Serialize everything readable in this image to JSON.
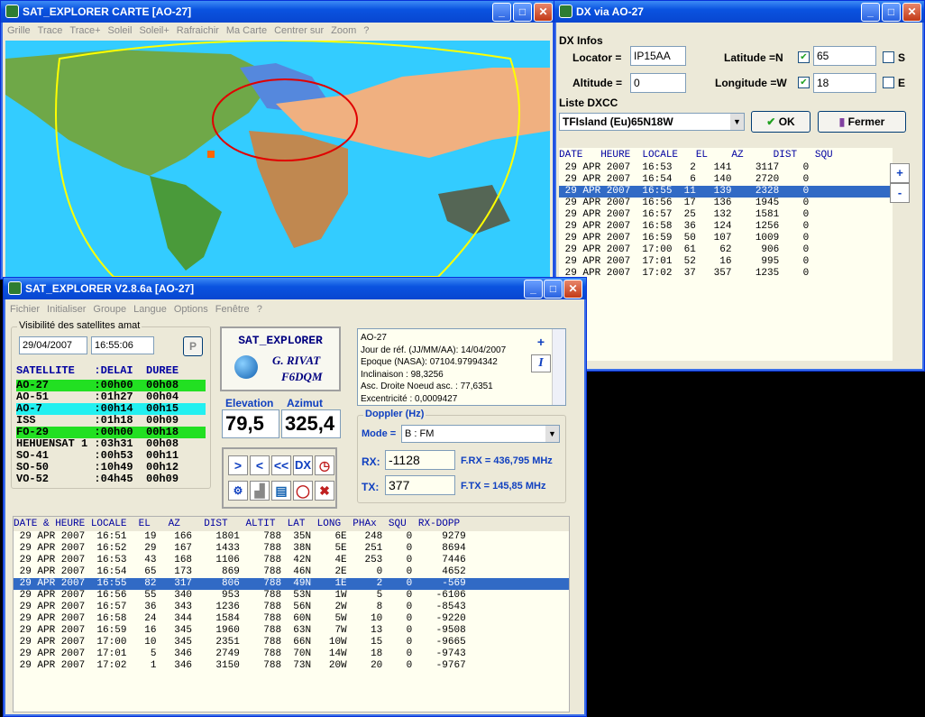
{
  "map_window": {
    "title": "SAT_EXPLORER CARTE [AO-27]",
    "menu": [
      "Grille",
      "Trace",
      "Trace+",
      "Soleil",
      "Soleil+",
      "Rafraichir",
      "Ma Carte",
      "Centrer sur",
      "Zoom",
      "?"
    ]
  },
  "dx_window": {
    "title": "DX via AO-27",
    "section": "DX Infos",
    "locator_label": "Locator =",
    "locator": "IP15AA",
    "altitude_label": "Altitude =",
    "altitude": "0",
    "latitude_label": "Latitude =N",
    "latitude": "65",
    "longitude_label": "Longitude =W",
    "longitude": "18",
    "s_label": "S",
    "e_label": "E",
    "liste_label": "Liste DXCC",
    "dxcc": "TFIsland (Eu)65N18W",
    "ok": "OK",
    "fermer": "Fermer",
    "columns": "DATE   HEURE  LOCALE   EL    AZ     DIST   SQU",
    "rows": [
      " 29 APR 2007  16:53   2   141    3117    0",
      " 29 APR 2007  16:54   6   140    2720    0",
      " 29 APR 2007  16:55  11   139    2328    0",
      " 29 APR 2007  16:56  17   136    1945    0",
      " 29 APR 2007  16:57  25   132    1581    0",
      " 29 APR 2007  16:58  36   124    1256    0",
      " 29 APR 2007  16:59  50   107    1009    0",
      " 29 APR 2007  17:00  61    62     906    0",
      " 29 APR 2007  17:01  52    16     995    0",
      " 29 APR 2007  17:02  37   357    1235    0"
    ],
    "selected": 2
  },
  "main_window": {
    "title": "SAT_EXPLORER V2.8.6a  [AO-27]",
    "menu": [
      "Fichier",
      "Initialiser",
      "Groupe",
      "Langue",
      "Options",
      "Fenêtre",
      "?"
    ],
    "vis_label": "Visibilité des satellites  amat",
    "date": "29/04/2007",
    "time": "16:55:06",
    "p_btn": "P",
    "sat_header": "SATELLITE   :DELAI  DUREE",
    "sats": [
      {
        "t": "AO-27       :00h00  00h08",
        "c": "#22e022"
      },
      {
        "t": "AO-51       :01h27  00h04",
        "c": ""
      },
      {
        "t": "AO-7        :00h14  00h15",
        "c": "#22f0f0"
      },
      {
        "t": "ISS         :01h18  00h09",
        "c": ""
      },
      {
        "t": "FO-29       :00h00  00h18",
        "c": "#22e022"
      },
      {
        "t": "HEHUENSAT 1 :03h31  00h08",
        "c": ""
      },
      {
        "t": "SO-41       :00h53  00h11",
        "c": ""
      },
      {
        "t": "SO-50       :10h49  00h12",
        "c": ""
      },
      {
        "t": "VO-52       :04h45  00h09",
        "c": ""
      }
    ],
    "logo": {
      "line1": "SAT_EXPLORER",
      "line2": "G. RIVAT",
      "line3": "F6DQM"
    },
    "elev_label": "Elevation",
    "elev": "79,5",
    "azim_label": "Azimut",
    "azim": "325,4",
    "ctrl": [
      ">",
      "<",
      "<<",
      "DX"
    ],
    "info": [
      "AO-27",
      "Jour de réf. (JJ/MM/AA): 14/04/2007",
      "Epoque (NASA): 07104.97994342",
      "Inclinaison : 98,3256",
      "Asc. Droite Noeud asc. : 77,6351",
      "Excentricité : 0,0009427"
    ],
    "doppler_label": "Doppler (Hz)",
    "mode_label": "Mode =",
    "mode": "B : FM",
    "rx_label": "RX:",
    "rx": "-1128",
    "frx": "F.RX = 436,795 MHz",
    "tx_label": "TX:",
    "tx": "377",
    "ftx": "F.TX = 145,85 MHz",
    "pass_header": "DATE & HEURE LOCALE  EL   AZ    DIST   ALTIT  LAT  LONG  PHAx  SQU  RX-DOPP",
    "pass_rows": [
      " 29 APR 2007  16:51   19   166    1801    788  35N    6E   248    0     9279",
      " 29 APR 2007  16:52   29   167    1433    788  38N    5E   251    0     8694",
      " 29 APR 2007  16:53   43   168    1106    788  42N    4E   253    0     7446",
      " 29 APR 2007  16:54   65   173     869    788  46N    2E     0    0     4652",
      " 29 APR 2007  16:55   82   317     806    788  49N    1E     2    0     -569",
      " 29 APR 2007  16:56   55   340     953    788  53N    1W     5    0    -6106",
      " 29 APR 2007  16:57   36   343    1236    788  56N    2W     8    0    -8543",
      " 29 APR 2007  16:58   24   344    1584    788  60N    5W    10    0    -9220",
      " 29 APR 2007  16:59   16   345    1960    788  63N    7W    13    0    -9508",
      " 29 APR 2007  17:00   10   345    2351    788  66N   10W    15    0    -9665",
      " 29 APR 2007  17:01    5   346    2749    788  70N   14W    18    0    -9743",
      " 29 APR 2007  17:02    1   346    3150    788  73N   20W    20    0    -9767"
    ],
    "pass_selected": 4
  }
}
